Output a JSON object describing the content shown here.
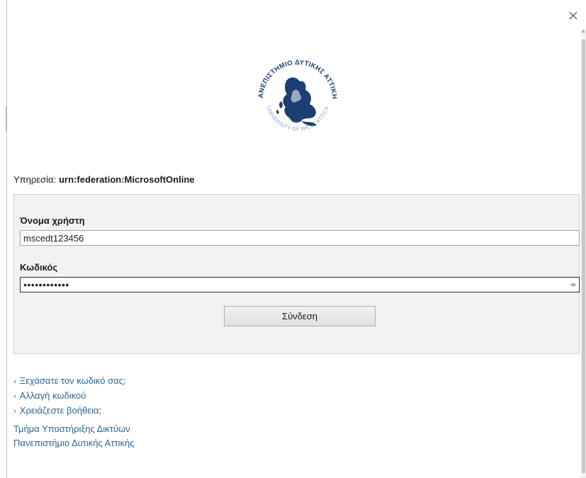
{
  "window": {
    "close_label": "×"
  },
  "logo": {
    "name": "university-seal",
    "top_text": "ΠΑΝΕΠΙΣΤΗΜΙΟ ΔΥΤΙΚΗΣ ΑΤΤΙΚΗΣ",
    "bottom_text": "UNIVERSITY OF WEST ATTICA",
    "color": "#1c3e73"
  },
  "service": {
    "label": "Υπηρεσία:",
    "value": "urn:federation:MicrosoftOnline"
  },
  "form": {
    "username_label": "Όνομα χρήστη",
    "username_value": "mscedt123456",
    "password_label": "Κωδικός",
    "password_value": "••••••••••••",
    "submit_label": "Σύνδεση"
  },
  "links": [
    {
      "label": "Ξεχάσατε τον κωδικό σας;"
    },
    {
      "label": "Αλλαγή κωδικού"
    },
    {
      "label": "Χρειάζεστε βοήθεια;"
    }
  ],
  "footer": {
    "line1": "Τμήμα Υποστήριξης Δικτύων",
    "line2": "Πανεπιστήμιο Δυτικής Αττικής"
  },
  "colors": {
    "link": "#2a6496",
    "caret": "#b83232",
    "panel_bg": "#f2f2f2"
  }
}
